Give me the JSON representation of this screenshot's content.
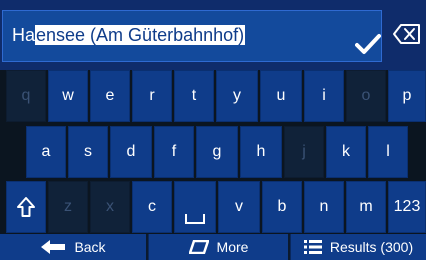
{
  "search": {
    "typed": "Ha",
    "suggestion": "ensee (Am Güterbahnhof)"
  },
  "icons": {
    "confirm": "check-icon",
    "delete": "backspace-icon",
    "shift": "shift-icon",
    "space": "space-icon",
    "back": "arrow-left-icon",
    "more": "more-icon",
    "results": "list-icon"
  },
  "keys": {
    "row1": [
      "q",
      "w",
      "e",
      "r",
      "t",
      "y",
      "u",
      "i",
      "o",
      "p"
    ],
    "row2": [
      "a",
      "s",
      "d",
      "f",
      "g",
      "h",
      "j",
      "k",
      "l"
    ],
    "row3": [
      "z",
      "x",
      "c",
      "v",
      "b",
      "n",
      "m"
    ],
    "numbers": "123"
  },
  "bottom": {
    "back": "Back",
    "more": "More",
    "results": "Results (300)"
  },
  "colors": {
    "key": "#0f3c8a",
    "disabled_key": "#102239",
    "background": "#0b1520"
  }
}
